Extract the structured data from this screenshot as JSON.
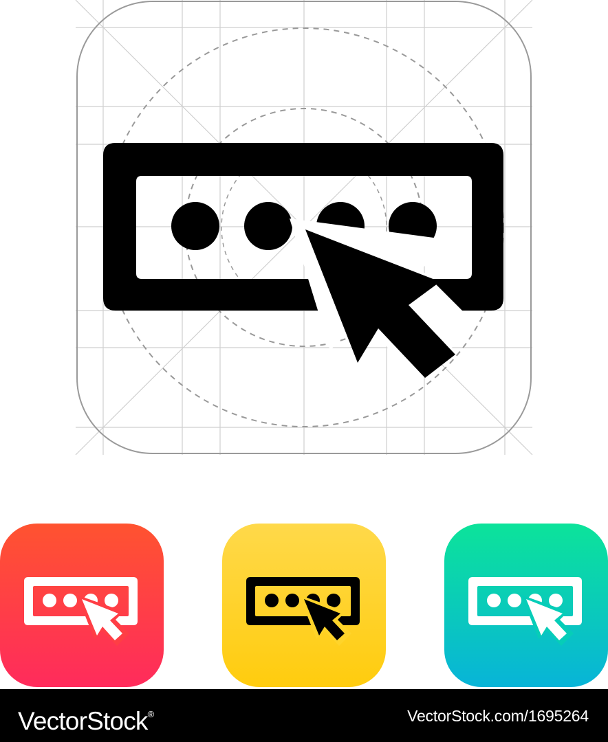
{
  "hero": {
    "icon": "password-entry-cursor-icon",
    "grid": "icon-design-grid",
    "colors": {
      "icon": "#000000",
      "grid": "#cccccc",
      "frame": "#999999",
      "guide_circles": "#999999"
    }
  },
  "variants": [
    {
      "icon": "password-entry-cursor-icon",
      "background": [
        "#ff5330",
        "#ff2b5c"
      ],
      "glyph_color": "#ffffff"
    },
    {
      "icon": "password-entry-cursor-icon",
      "background": [
        "#ffd94a",
        "#ffcc0e"
      ],
      "glyph_color": "#000000"
    },
    {
      "icon": "password-entry-cursor-icon",
      "background": [
        "#0ce39a",
        "#08b4d8"
      ],
      "glyph_color": "#ffffff"
    }
  ],
  "footer": {
    "brand": "VectorStock",
    "brand_mark": "®",
    "image_ref": "VectorStock.com/1695264",
    "background": "#000000",
    "text_color": "#ffffff"
  }
}
